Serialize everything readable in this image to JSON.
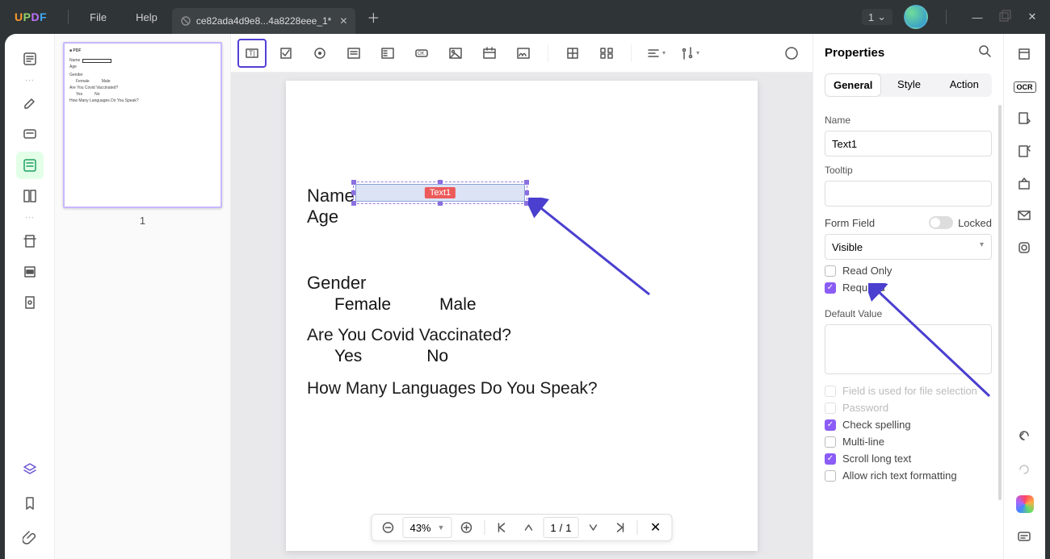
{
  "titlebar": {
    "logo": "UPDF",
    "file": "File",
    "help": "Help",
    "tab_name": "ce82ada4d9e8...4a8228eee_1*",
    "dropdown_value": "1"
  },
  "left_rail": {
    "tools": [
      "reader",
      "text",
      "comment",
      "form",
      "organize",
      "crop",
      "redact",
      "protect"
    ]
  },
  "thumbnail": {
    "page_number": "1",
    "mini_lines": {
      "name": "Name",
      "age": "Age",
      "gender": "Gender",
      "female": "Female",
      "male": "Male",
      "vacc": "Are You Covid Vaccinated?",
      "yes": "Yes",
      "no": "No",
      "langs": "How Many Languages Do You Speak?"
    }
  },
  "toolbar": {
    "items": [
      "text-field",
      "checkbox",
      "radio",
      "list",
      "combo",
      "button",
      "image",
      "date",
      "signature"
    ]
  },
  "page": {
    "name": "Name",
    "age": "Age",
    "gender": "Gender",
    "female": "Female",
    "male": "Male",
    "vacc": "Are You Covid Vaccinated?",
    "yes": "Yes",
    "no": "No",
    "langs": "How Many Languages Do You Speak?",
    "field_tag": "Text1"
  },
  "footer": {
    "zoom": "43%",
    "page_current": "1",
    "page_sep": "/",
    "page_total": "1"
  },
  "props": {
    "title": "Properties",
    "tabs": {
      "general": "General",
      "style": "Style",
      "action": "Action"
    },
    "name_label": "Name",
    "name_value": "Text1",
    "tooltip_label": "Tooltip",
    "tooltip_value": "",
    "formfield_label": "Form Field",
    "locked_label": "Locked",
    "visibility_value": "Visible",
    "readonly_label": "Read Only",
    "required_label": "Required",
    "default_label": "Default Value",
    "default_value": "",
    "fileselection_label": "Field is used for file selection",
    "password_label": "Password",
    "checkspell_label": "Check spelling",
    "multiline_label": "Multi-line",
    "scroll_label": "Scroll long text",
    "richtext_label": "Allow rich text formatting"
  },
  "right_rail": {
    "ocr": "OCR"
  }
}
